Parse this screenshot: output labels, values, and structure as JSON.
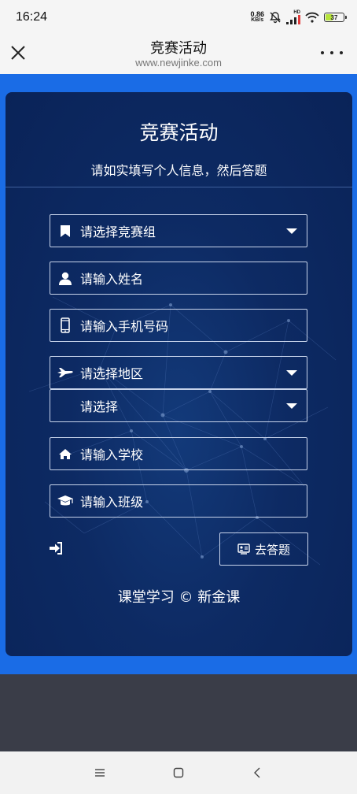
{
  "status_bar": {
    "time": "16:24",
    "net_speed_value": "0.86",
    "net_speed_unit": "KB/s",
    "signal_label": "HD",
    "battery": "37",
    "battery_level": 0.37
  },
  "title_bar": {
    "title": "竞赛活动",
    "url": "www.newjinke.com"
  },
  "card": {
    "title": "竞赛活动",
    "subtitle": "请如实填写个人信息，然后答题"
  },
  "form": {
    "competition_group": "请选择竞赛组",
    "name": "请输入姓名",
    "phone": "请输入手机号码",
    "region": "请选择地区",
    "sub_region": "请选择",
    "school": "请输入学校",
    "class_name": "请输入班级"
  },
  "actions": {
    "go_answer": "去答题"
  },
  "footer": {
    "text": "课堂学习 © 新金课"
  },
  "icons": {
    "competition_group": "bookmark-icon",
    "name": "user-icon",
    "phone": "mobile-icon",
    "region": "plane-icon",
    "school": "home-icon",
    "class_name": "graduation-cap-icon",
    "login": "sign-in-icon",
    "go_answer": "id-card-icon"
  },
  "colors": {
    "accent_blue": "#1a6ce6",
    "card_bg": "#0d2a63",
    "bottom_gray": "#3a3d48"
  }
}
